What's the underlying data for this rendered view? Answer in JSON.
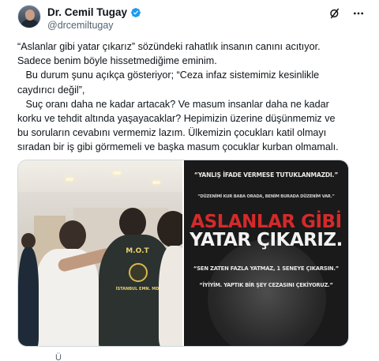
{
  "author": {
    "display_name": "Dr. Cemil Tugay",
    "handle": "@drcemiltugay"
  },
  "icons": {
    "verified": "verified-badge-icon",
    "grok": "grok-icon",
    "more": "more-options-icon"
  },
  "colors": {
    "verified": "#1d9bf0",
    "text": "#0f1419",
    "muted": "#536471",
    "headline_red": "#d42a2a"
  },
  "tweet": {
    "paragraphs": [
      "“Aslanlar gibi yatar çıkarız” sözündeki rahatlık insanın canını acıtıyor.\nSadece benim böyle hissetmediğime eminim.",
      "   Bu durum şunu açıkça gösteriyor; “Ceza infaz sistemimiz kesinlikle\ncaydırıcı değil”,",
      "   Suç oranı daha ne kadar artacak? Ve masum insanlar daha ne kadar\nkorku ve tehdit altında yaşayacaklar? Hepimizin üzerine düşünmemiz ve\nbu soruların cevabını vermemiz lazım. Ülkemizin çocukları katil olmayı\nsıradan bir iş gibi görmemeli ve başka masum çocuklar kurban olmamalı."
    ]
  },
  "media": {
    "left_photo": {
      "vest_text": "M.O.T",
      "vest_subtext": "İSTANBUL EMN. MD."
    },
    "right_graphic": {
      "quote1": "“YANLIŞ İFADE VERMESE TUTUKLANMAZDI.”",
      "quote2": "“DÜZENİMİ KUR BABA ORADA, BENİM BURADA DÜZENİM VAR.”",
      "headline_line1": "ASLANLAR GİBİ",
      "headline_line2": "YATAR ÇIKARIZ.",
      "quote3": "“SEN ZATEN FAZLA YATMAZ, 1 SENEYE ÇIKARSIN.”",
      "quote4": "“İYİYİM. YAPTIK BİR ŞEY CEZASINI ÇEKİYORUZ.”"
    }
  },
  "footer_peek": "Ü"
}
